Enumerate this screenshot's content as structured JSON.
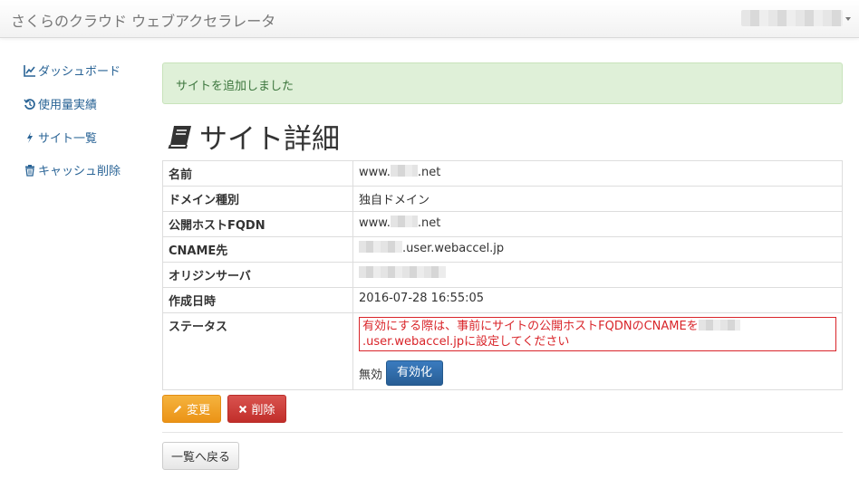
{
  "navbar": {
    "brand": "さくらのクラウド ウェブアクセラレータ"
  },
  "sidebar": {
    "items": [
      {
        "label": "ダッシュボード",
        "icon": "chart-line-icon"
      },
      {
        "label": "使用量実績",
        "icon": "history-icon"
      },
      {
        "label": "サイト一覧",
        "icon": "bolt-icon"
      },
      {
        "label": "キャッシュ削除",
        "icon": "trash-icon"
      }
    ]
  },
  "alert": {
    "text": "サイトを追加しました"
  },
  "page": {
    "title": "サイト詳細",
    "title_icon": "book-icon"
  },
  "details": {
    "rows": [
      {
        "label": "名前",
        "prefix": "www.",
        "suffix": ".net"
      },
      {
        "label": "ドメイン種別",
        "value": "独自ドメイン"
      },
      {
        "label": "公開ホストFQDN",
        "prefix": "www.",
        "suffix": ".net"
      },
      {
        "label": "CNAME先",
        "suffix": ".user.webaccel.jp"
      },
      {
        "label": "オリジンサーバ"
      },
      {
        "label": "作成日時",
        "value": "2016-07-28 16:55:05"
      },
      {
        "label": "ステータス"
      }
    ],
    "status_warning_before": "有効にする際は、事前にサイトの公開ホストFQDNのCNAMEを",
    "status_warning_after": ".user.webaccel.jpに設定してください",
    "status_value": "無効",
    "enable_button": "有効化"
  },
  "actions": {
    "edit_label": "変更",
    "delete_label": "削除",
    "back_label": "一覧へ戻る"
  },
  "colors": {
    "link": "#2a6496",
    "alert_bg": "#dff0d8",
    "alert_text": "#3c763d",
    "warning": "#d9252a",
    "primary": "#285e95",
    "edit": "#eb9316",
    "delete": "#c12e2a"
  }
}
